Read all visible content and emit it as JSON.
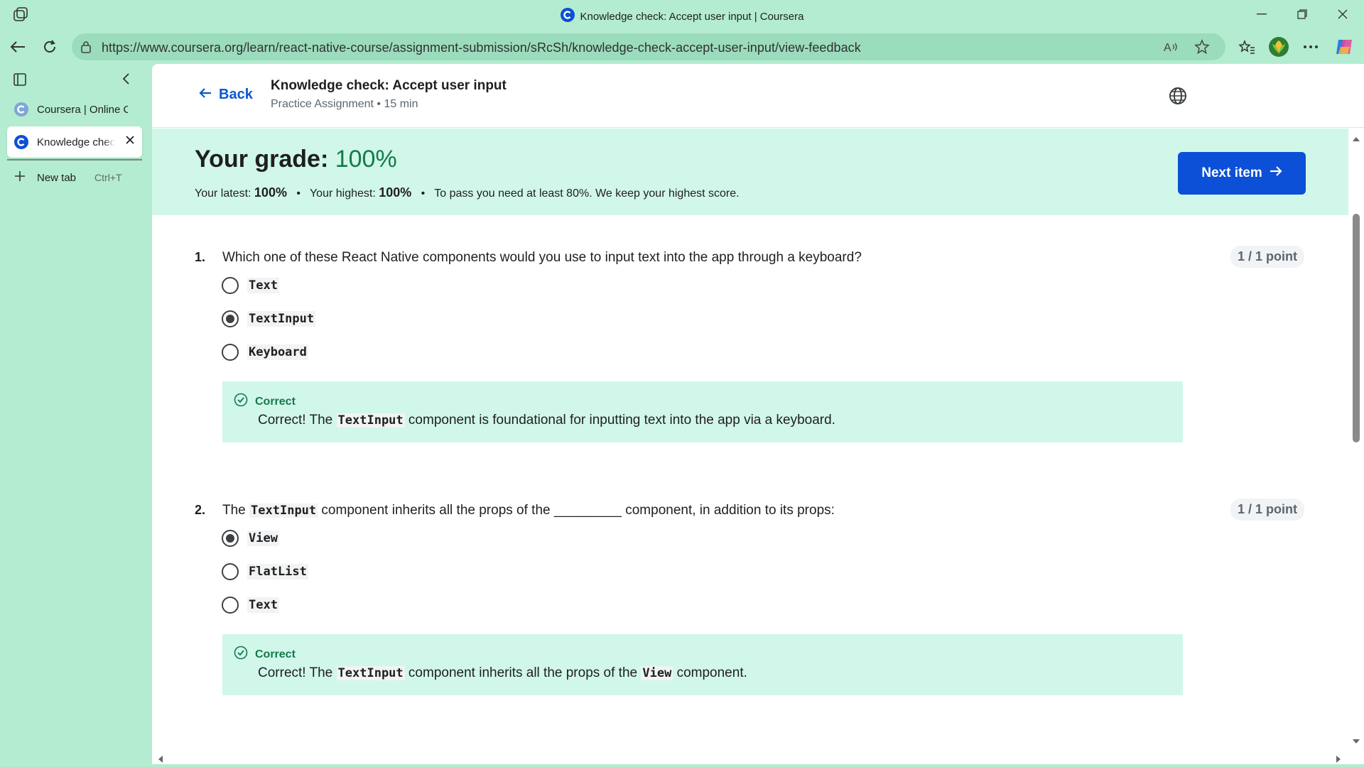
{
  "window": {
    "title": "Knowledge check: Accept user input | Coursera"
  },
  "address_bar": {
    "url": "https://www.coursera.org/learn/react-native-course/assignment-submission/sRcSh/knowledge-check-accept-user-input/view-feedback"
  },
  "sidebar": {
    "tabs": [
      {
        "label": "Coursera | Online Co",
        "active": false
      },
      {
        "label": "Knowledge check: Accept user input",
        "active": true
      }
    ],
    "new_tab_label": "New tab",
    "new_tab_shortcut": "Ctrl+T"
  },
  "header": {
    "back_label": "Back",
    "title": "Knowledge check: Accept user input",
    "subtitle": "Practice Assignment • 15 min"
  },
  "grade": {
    "label": "Your grade: ",
    "value": "100%",
    "latest_label": "Your latest:",
    "latest_value": "100%",
    "highest_label": "Your highest:",
    "highest_value": "100%",
    "pass_note": "To pass you need at least 80%. We keep your highest score.",
    "next_button": "Next item"
  },
  "questions": [
    {
      "number": "1.",
      "text": "Which one of these React Native components would you use to input text into the app through a keyboard?",
      "points": "1 / 1 point",
      "options": [
        "Text",
        "TextInput",
        "Keyboard"
      ],
      "selected_index": 1,
      "feedback_head": "Correct",
      "feedback_pre": "Correct! The ",
      "feedback_code": "TextInput",
      "feedback_post": " component is foundational for inputting text into the app via a keyboard."
    },
    {
      "number": "2.",
      "text_pre": "The ",
      "text_code": "TextInput",
      "text_post": " component inherits all the props of the _________ component, in addition to its props:",
      "points": "1 / 1 point",
      "options": [
        "View",
        "FlatList",
        "Text"
      ],
      "selected_index": 0,
      "feedback_head": "Correct",
      "feedback_pre": "Correct! The ",
      "feedback_code": "TextInput",
      "feedback_mid": " component inherits all the props of the ",
      "feedback_code2": "View",
      "feedback_post": " component."
    }
  ],
  "colors": {
    "frame": "#b3ecd0",
    "accent_blue": "#0b50d6",
    "correct_green": "#137a4b",
    "band_bg": "#d1f7ea"
  }
}
